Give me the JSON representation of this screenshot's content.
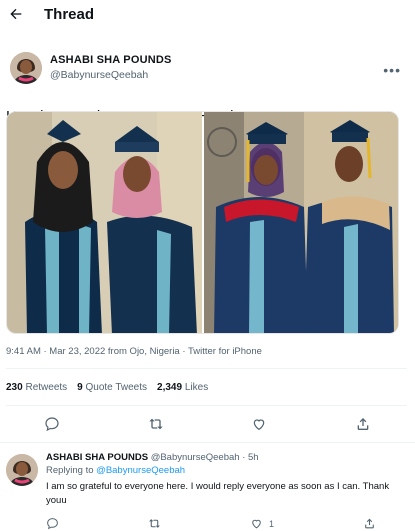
{
  "header": {
    "title": "Thread"
  },
  "tweet": {
    "author": {
      "display_name": "ASHABI SHA POUNDS",
      "handle": "@BabynurseQeebah"
    },
    "text_left": "How it Started.",
    "text_right": "How it went.",
    "meta": "9:41 AM · Mar 23, 2022 from Ojo, Nigeria · Twitter for iPhone",
    "stats": {
      "retweets_count": "230",
      "retweets_label": "Retweets",
      "quotes_count": "9",
      "quotes_label": "Quote Tweets",
      "likes_count": "2,349",
      "likes_label": "Likes"
    }
  },
  "reply": {
    "display_name": "ASHABI SHA POUNDS",
    "handle_time": "@BabynurseQeebah · 5h",
    "replying_prefix": "Replying to",
    "replying_to": "@BabynurseQeebah",
    "text": "I am so grateful to everyone here. I would reply everyone as soon as I can. Thank youu",
    "like_count": "1"
  },
  "icons": [
    "back-arrow-icon",
    "more-icon",
    "reply-icon",
    "retweet-icon",
    "like-icon",
    "share-icon"
  ],
  "colors": {
    "accent": "#1d9bf0",
    "muted": "#536471",
    "text": "#0f1419"
  }
}
